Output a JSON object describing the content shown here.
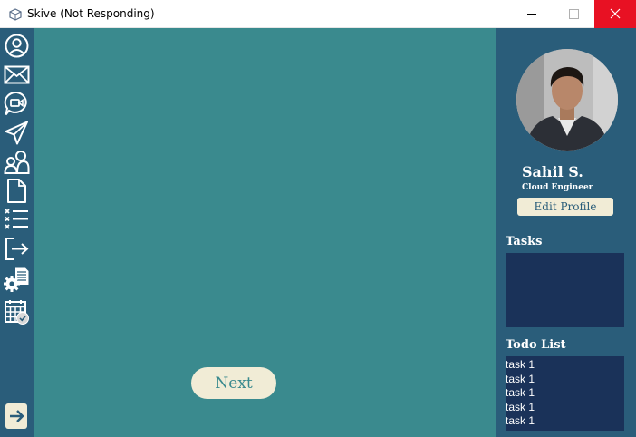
{
  "window": {
    "title": "Skive (Not Responding)",
    "controls": [
      "minimize",
      "maximize",
      "close"
    ],
    "close_color": "#e81123"
  },
  "colors": {
    "sidebar": "#2a5d7a",
    "main": "#3a8a8e",
    "accent_cream": "#f1ecd6",
    "list_box": "#1a3259"
  },
  "sidebar": {
    "icons": [
      "user-circle-icon",
      "mail-icon",
      "video-chat-icon",
      "send-icon",
      "people-icon",
      "file-icon",
      "checklist-icon",
      "logout-icon",
      "settings-document-icon",
      "calendar-check-icon"
    ],
    "bottom_icon": "arrow-right-icon"
  },
  "main": {
    "next_label": "Next"
  },
  "profile": {
    "name": "Sahil S.",
    "role": "Cloud Engineer",
    "edit_label": "Edit Profile",
    "tasks_label": "Tasks",
    "todo_label": "Todo List",
    "todo_items": [
      "task 1",
      "task 1",
      "task 1",
      "task 1",
      "task 1"
    ]
  }
}
